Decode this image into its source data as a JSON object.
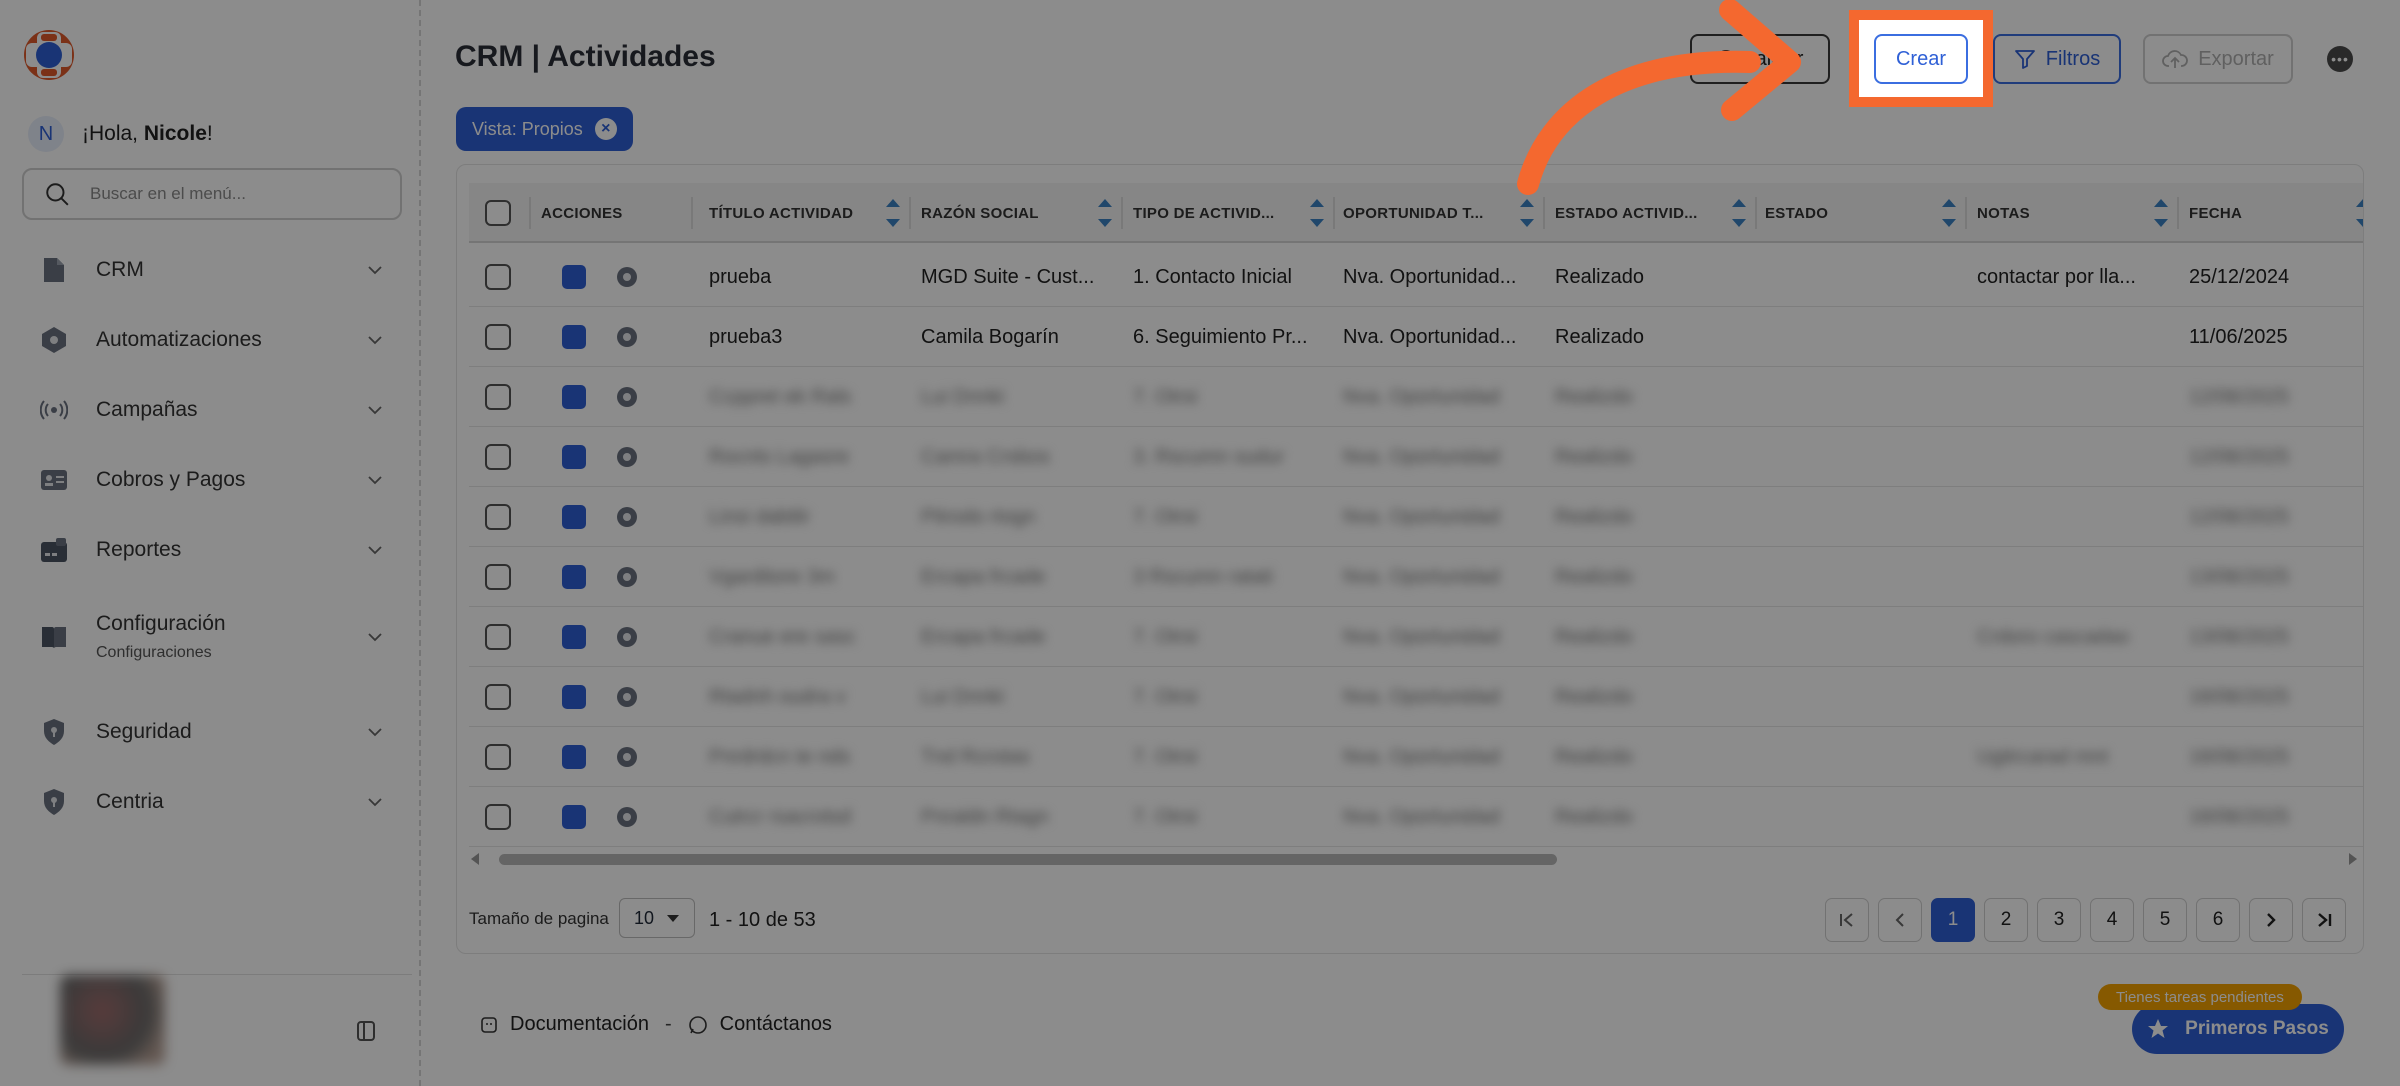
{
  "app": {
    "greeting_prefix": "¡Hola, ",
    "greeting_name": "Nicole",
    "greeting_suffix": "!",
    "user_initial": "N"
  },
  "menu_search": {
    "placeholder": "Buscar en el menú..."
  },
  "sidebar": {
    "items": [
      {
        "label": "CRM",
        "icon": "document-icon"
      },
      {
        "label": "Automatizaciones",
        "icon": "hexagon-gear-icon"
      },
      {
        "label": "Campañas",
        "icon": "broadcast-icon"
      },
      {
        "label": "Cobros y Pagos",
        "icon": "id-card-icon"
      },
      {
        "label": "Reportes",
        "icon": "wallet-icon"
      },
      {
        "label": "Configuración",
        "sublabel": "Configuraciones",
        "icon": "book-icon"
      },
      {
        "label": "Seguridad",
        "icon": "shield-lock-icon"
      },
      {
        "label": "Centria",
        "icon": "shield-lock-icon"
      }
    ]
  },
  "page": {
    "title": "CRM | Actividades"
  },
  "toolbar": {
    "actualizar_label": "ualizar",
    "crear_label": "Crear",
    "filtros_label": "Filtros",
    "exportar_label": "Exportar"
  },
  "view_chip": {
    "label": "Vista: Propios"
  },
  "table": {
    "headers": [
      "Acciones",
      "Título actividad",
      "Razón social",
      "Tipo de activid...",
      "Oportunidad t...",
      "Estado activid...",
      "Estado",
      "Notas",
      "Fecha"
    ],
    "rows": [
      {
        "titulo": "prueba",
        "razon": "MGD Suite - Cust...",
        "tipo": "1. Contacto Inicial",
        "oportunidad": "Nva. Oportunidad...",
        "estado_act": "Realizado",
        "estado": "",
        "notas": "contactar por lla...",
        "fecha": "25/12/2024",
        "blurred": false
      },
      {
        "titulo": "prueba3",
        "razon": "Camila Bogarín",
        "tipo": "6. Seguimiento Pr...",
        "oportunidad": "Nva. Oportunidad...",
        "estado_act": "Realizado",
        "estado": "",
        "notas": "",
        "fecha": "11/06/2025",
        "blurred": false
      },
      {
        "titulo": "Ccppret ek Rals",
        "razon": "Lui Dnnki",
        "tipo": "7. Otrsi",
        "oportunidad": "Nva. Oportunidad",
        "estado_act": "Realizdo",
        "estado": "",
        "notas": "",
        "fecha": "12/06/2025",
        "blurred": true
      },
      {
        "titulo": "Rocnts Lagasre",
        "razon": "Camra Crsbos",
        "tipo": "3. Rscumn sudur",
        "oportunidad": "Nva. Oportunidad",
        "estado_act": "Realizdo",
        "estado": "",
        "notas": "",
        "fecha": "12/06/2025",
        "blurred": true
      },
      {
        "titulo": "Linsi dabtlir",
        "razon": "Ptirodo rtogn",
        "tipo": "7. Otrsi",
        "oportunidad": "Nva. Oportunidad",
        "estado_act": "Realizdo",
        "estado": "",
        "notas": "",
        "fecha": "12/06/2025",
        "blurred": true
      },
      {
        "titulo": "Vgarditore 3m",
        "razon": "Ercapa frcade",
        "tipo": "3 Rscumn ratati",
        "oportunidad": "Nva. Oportunidad",
        "estado_act": "Realizdo",
        "estado": "",
        "notas": "",
        "fecha": "13/06/2025",
        "blurred": true
      },
      {
        "titulo": "Cranue ere sasc",
        "razon": "Ercapa frcade",
        "tipo": "7. Otrsi",
        "oportunidad": "Nva. Oportunidad",
        "estado_act": "Realizdo",
        "estado": "",
        "notas": "Crdoro cascadao",
        "fecha": "13/06/2025",
        "blurred": true
      },
      {
        "titulo": "Rtadnh oudra v",
        "razon": "Lui Dnnki",
        "tipo": "7. Otrsi",
        "oportunidad": "Nva. Oportunidad",
        "estado_act": "Realizdo",
        "estado": "",
        "notas": "",
        "fecha": "16/06/2025",
        "blurred": true
      },
      {
        "titulo": "Pnrdrdcn te nds",
        "razon": "Tnd Rcrotas",
        "tipo": "7. Otrsi",
        "oportunidad": "Nva. Oportunidad",
        "estado_act": "Realizdo",
        "estado": "",
        "notas": "Ugitrcarad mnt",
        "fecha": "16/06/2025",
        "blurred": true
      },
      {
        "titulo": "Cutrcr rsacrotsd",
        "razon": "Pnraldn Rtagn",
        "tipo": "7. Otrsi",
        "oportunidad": "Nva. Oportunidad",
        "estado_act": "Realizdo",
        "estado": "",
        "notas": "",
        "fecha": "16/06/2025",
        "blurred": true
      }
    ]
  },
  "pagination": {
    "page_size_label": "Tamaño de pagina",
    "page_size_value": "10",
    "range_label": "1 - 10 de 53",
    "pages": [
      "1",
      "2",
      "3",
      "4",
      "5",
      "6"
    ],
    "active_page": "1"
  },
  "footer": {
    "docs_label": "Documentación",
    "separator": "-",
    "contact_label": "Contáctanos"
  },
  "assist": {
    "pending_label": "Tienes tareas pendientes",
    "primeros_label": "Primeros Pasos"
  },
  "colors": {
    "brand": "#2f60d6",
    "highlight": "#f4682f",
    "pending": "#f5a300"
  }
}
